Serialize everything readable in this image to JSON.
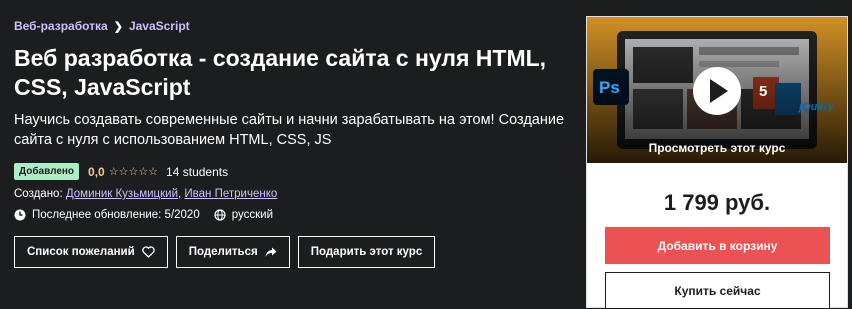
{
  "breadcrumb": {
    "items": [
      "Веб-разработка",
      "JavaScript"
    ]
  },
  "course": {
    "title": "Веб разработка - создание сайта с нуля HTML, CSS, JavaScript",
    "subtitle": "Научись создавать современные сайты и начни зарабатывать на этом! Создание сайта с нуля с использованием HTML, CSS, JS",
    "badge": "Добавлено",
    "rating": "0,0",
    "stars": "☆☆☆☆☆",
    "students": "14 students",
    "created_label": "Создано:",
    "authors": [
      "Доминик Кузьмицкий",
      "Иван Петриченко"
    ],
    "author_separator": ",",
    "updated": "Последнее обновление: 5/2020",
    "language": "русский"
  },
  "actions": {
    "wishlist": "Список пожеланий",
    "share": "Поделиться",
    "gift": "Подарить этот курс"
  },
  "sidebar": {
    "preview_label": "Просмотреть этот курс",
    "preview_logos": {
      "ps": "Ps",
      "jquery": "jQuery",
      "html5": "5"
    },
    "price": "1 799 руб.",
    "add_to_cart": "Добавить в корзину",
    "buy_now": "Купить сейчас"
  },
  "colors": {
    "background": "#1c1d1f",
    "link": "#cec0fc",
    "rating": "#f3ca8c",
    "badge_bg": "#aceec6",
    "cart_button": "#ec5252",
    "preview_bg": "#f6a92c"
  }
}
